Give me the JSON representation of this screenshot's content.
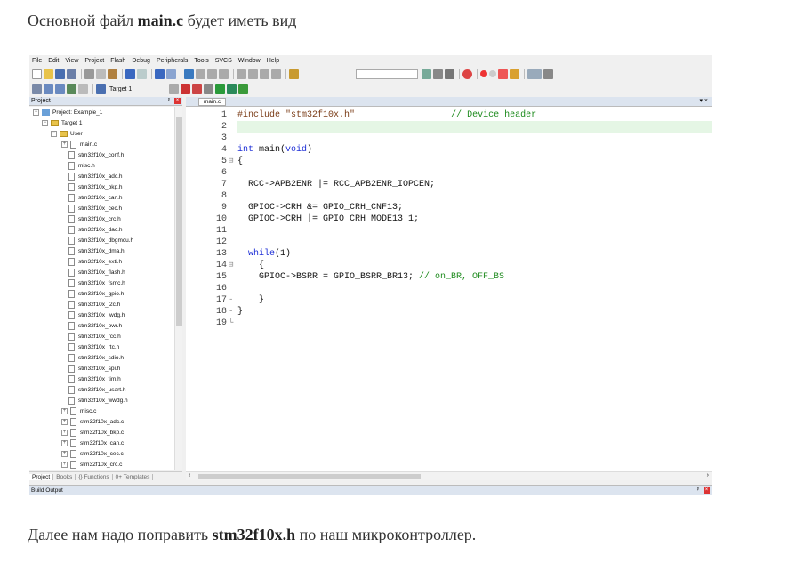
{
  "paragraph1": {
    "before": "Основной файл ",
    "bold": "main.c",
    "after": " будет иметь вид"
  },
  "paragraph2": {
    "before": "Далее нам надо поправить ",
    "bold": "stm32f10x.h",
    "after": " по наш микроконтроллер."
  },
  "ide": {
    "menu": [
      "File",
      "Edit",
      "View",
      "Project",
      "Flash",
      "Debug",
      "Peripherals",
      "Tools",
      "SVCS",
      "Window",
      "Help"
    ],
    "target_label": "Target 1",
    "project_panel_title": "Project",
    "project_tabs": [
      "Project",
      "Books",
      "{} Functions",
      "0+ Templates"
    ],
    "editor_tab": "main.c",
    "build_output_title": "Build Output",
    "tree": [
      {
        "label": "Project: Example_1",
        "indent": 0,
        "type": "project",
        "exp": "⊟"
      },
      {
        "label": "Target 1",
        "indent": 1,
        "type": "folder",
        "exp": "⊟"
      },
      {
        "label": "User",
        "indent": 2,
        "type": "folder",
        "exp": "⊟"
      },
      {
        "label": "main.c",
        "indent": 3,
        "type": "file",
        "exp": "⊞"
      },
      {
        "label": "stm32f10x_conf.h",
        "indent": 4,
        "type": "file"
      },
      {
        "label": "misc.h",
        "indent": 4,
        "type": "file"
      },
      {
        "label": "stm32f10x_adc.h",
        "indent": 4,
        "type": "file"
      },
      {
        "label": "stm32f10x_bkp.h",
        "indent": 4,
        "type": "file"
      },
      {
        "label": "stm32f10x_can.h",
        "indent": 4,
        "type": "file"
      },
      {
        "label": "stm32f10x_cec.h",
        "indent": 4,
        "type": "file"
      },
      {
        "label": "stm32f10x_crc.h",
        "indent": 4,
        "type": "file"
      },
      {
        "label": "stm32f10x_dac.h",
        "indent": 4,
        "type": "file"
      },
      {
        "label": "stm32f10x_dbgmcu.h",
        "indent": 4,
        "type": "file"
      },
      {
        "label": "stm32f10x_dma.h",
        "indent": 4,
        "type": "file"
      },
      {
        "label": "stm32f10x_exti.h",
        "indent": 4,
        "type": "file"
      },
      {
        "label": "stm32f10x_flash.h",
        "indent": 4,
        "type": "file"
      },
      {
        "label": "stm32f10x_fsmc.h",
        "indent": 4,
        "type": "file"
      },
      {
        "label": "stm32f10x_gpio.h",
        "indent": 4,
        "type": "file"
      },
      {
        "label": "stm32f10x_i2c.h",
        "indent": 4,
        "type": "file"
      },
      {
        "label": "stm32f10x_iwdg.h",
        "indent": 4,
        "type": "file"
      },
      {
        "label": "stm32f10x_pwr.h",
        "indent": 4,
        "type": "file"
      },
      {
        "label": "stm32f10x_rcc.h",
        "indent": 4,
        "type": "file"
      },
      {
        "label": "stm32f10x_rtc.h",
        "indent": 4,
        "type": "file"
      },
      {
        "label": "stm32f10x_sdio.h",
        "indent": 4,
        "type": "file"
      },
      {
        "label": "stm32f10x_spi.h",
        "indent": 4,
        "type": "file"
      },
      {
        "label": "stm32f10x_tim.h",
        "indent": 4,
        "type": "file"
      },
      {
        "label": "stm32f10x_usart.h",
        "indent": 4,
        "type": "file"
      },
      {
        "label": "stm32f10x_wwdg.h",
        "indent": 4,
        "type": "file"
      },
      {
        "label": "misc.c",
        "indent": 3,
        "type": "file",
        "exp": "⊞"
      },
      {
        "label": "stm32f10x_adc.c",
        "indent": 3,
        "type": "file",
        "exp": "⊞"
      },
      {
        "label": "stm32f10x_bkp.c",
        "indent": 3,
        "type": "file",
        "exp": "⊞"
      },
      {
        "label": "stm32f10x_can.c",
        "indent": 3,
        "type": "file",
        "exp": "⊞"
      },
      {
        "label": "stm32f10x_cec.c",
        "indent": 3,
        "type": "file",
        "exp": "⊞"
      },
      {
        "label": "stm32f10x_crc.c",
        "indent": 3,
        "type": "file",
        "exp": "⊞"
      }
    ],
    "code": [
      {
        "n": "1",
        "segs": [
          [
            "pp",
            "#include "
          ],
          [
            "st",
            "\"stm32f10x.h\""
          ],
          [
            "",
            "                  "
          ],
          [
            "cm",
            "// Device header"
          ]
        ]
      },
      {
        "n": "2",
        "hl": true,
        "segs": []
      },
      {
        "n": "3",
        "segs": []
      },
      {
        "n": "4",
        "segs": [
          [
            "kw",
            "int"
          ],
          [
            "",
            " main("
          ],
          [
            "kw",
            "void"
          ],
          [
            "",
            ")"
          ]
        ]
      },
      {
        "n": "5",
        "fold": "⊟",
        "segs": [
          [
            "",
            "{"
          ]
        ]
      },
      {
        "n": "6",
        "segs": []
      },
      {
        "n": "7",
        "segs": [
          [
            "",
            "  RCC->APB2ENR |= RCC_APB2ENR_IOPCEN;"
          ]
        ]
      },
      {
        "n": "8",
        "segs": []
      },
      {
        "n": "9",
        "segs": [
          [
            "",
            "  GPIOC->CRH &= GPIO_CRH_CNF13;"
          ]
        ]
      },
      {
        "n": "10",
        "segs": [
          [
            "",
            "  GPIOC->CRH |= GPIO_CRH_MODE13_1;"
          ]
        ]
      },
      {
        "n": "11",
        "segs": []
      },
      {
        "n": "12",
        "segs": []
      },
      {
        "n": "13",
        "segs": [
          [
            "",
            "  "
          ],
          [
            "kw",
            "while"
          ],
          [
            "",
            "(1)"
          ]
        ]
      },
      {
        "n": "14",
        "fold": "⊟",
        "segs": [
          [
            "",
            "    {"
          ]
        ]
      },
      {
        "n": "15",
        "segs": [
          [
            "",
            "    GPIOC->BSRR = GPIO_BSRR_BR13; "
          ],
          [
            "cm",
            "// on_BR, OFF_BS"
          ]
        ]
      },
      {
        "n": "16",
        "segs": []
      },
      {
        "n": "17",
        "fold": "-",
        "segs": [
          [
            "",
            "    }"
          ]
        ]
      },
      {
        "n": "18",
        "fold": "-",
        "segs": [
          [
            "",
            "}"
          ]
        ]
      },
      {
        "n": "19",
        "fold": "└",
        "segs": []
      }
    ]
  }
}
